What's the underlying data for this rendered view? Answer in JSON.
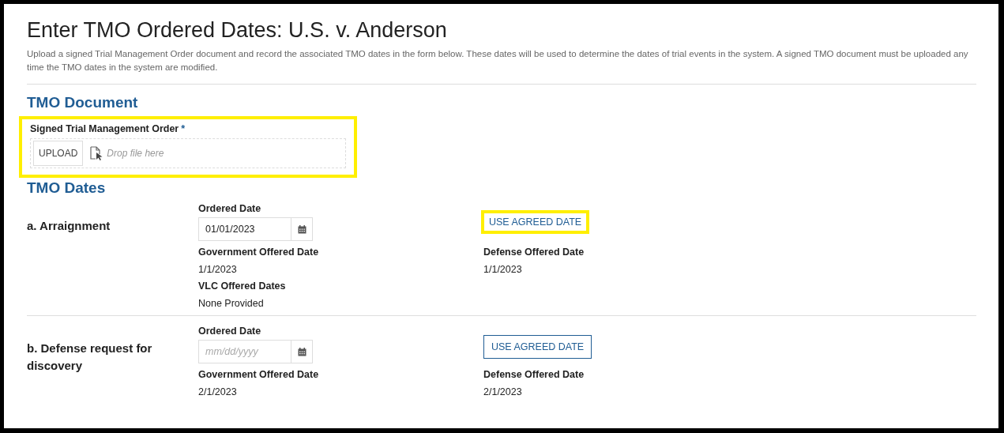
{
  "title": "Enter TMO Ordered Dates: U.S. v. Anderson",
  "description": "Upload a signed Trial Management Order document and record the associated TMO dates in the form below. These dates will be used to determine the dates of trial events in the system. A signed TMO document must be uploaded any time the TMO dates in the system are modified.",
  "document_section": {
    "heading": "TMO Document",
    "label": "Signed Trial Management Order",
    "required_mark": "*",
    "upload_button": "UPLOAD",
    "drop_placeholder": "Drop file here",
    "highlighted": true
  },
  "dates_section": {
    "heading": "TMO Dates",
    "events": [
      {
        "name": "a. Arraignment",
        "ordered_label": "Ordered Date",
        "ordered_value": "01/01/2023",
        "agreed_button": "USE AGREED DATE",
        "highlighted": true,
        "offers": [
          {
            "label": "Government Offered Date",
            "value": "1/1/2023"
          },
          {
            "label": "Defense Offered Date",
            "value": "1/1/2023"
          },
          {
            "label": "VLC Offered Dates",
            "value": "None Provided"
          }
        ]
      },
      {
        "name": "b. Defense request for discovery",
        "ordered_label": "Ordered Date",
        "ordered_placeholder": "mm/dd/yyyy",
        "agreed_button": "USE AGREED DATE",
        "highlighted": false,
        "offers": [
          {
            "label": "Government Offered Date",
            "value": "2/1/2023"
          },
          {
            "label": "Defense Offered Date",
            "value": "2/1/2023"
          }
        ]
      }
    ]
  }
}
